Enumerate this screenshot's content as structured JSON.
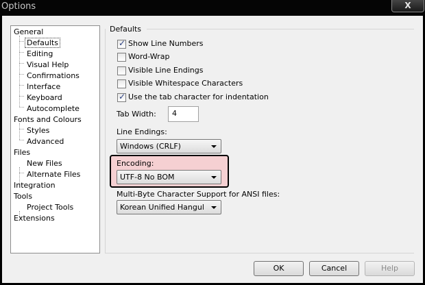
{
  "window": {
    "title": "Options",
    "close_glyph": "X"
  },
  "tree": {
    "items": [
      {
        "label": "General"
      },
      {
        "label": "Defaults",
        "selected": true
      },
      {
        "label": "Editing"
      },
      {
        "label": "Visual Help"
      },
      {
        "label": "Confirmations"
      },
      {
        "label": "Interface"
      },
      {
        "label": "Keyboard"
      },
      {
        "label": "Autocomplete"
      },
      {
        "label": "Fonts and Colours"
      },
      {
        "label": "Styles"
      },
      {
        "label": "Advanced"
      },
      {
        "label": "Files"
      },
      {
        "label": "New Files"
      },
      {
        "label": "Alternate Files"
      },
      {
        "label": "Integration"
      },
      {
        "label": "Tools"
      },
      {
        "label": "Project Tools"
      },
      {
        "label": "Extensions"
      }
    ]
  },
  "defaults": {
    "group_title": "Defaults",
    "checkboxes": [
      {
        "label": "Show Line Numbers",
        "checked": true
      },
      {
        "label": "Word-Wrap",
        "checked": false
      },
      {
        "label": "Visible Line Endings",
        "checked": false
      },
      {
        "label": "Visible Whitespace Characters",
        "checked": false
      },
      {
        "label": "Use the tab character for indentation",
        "checked": true
      }
    ],
    "check_glyph": "✓",
    "tab_width_label": "Tab Width:",
    "tab_width_value": "4",
    "line_endings_label": "Line Endings:",
    "line_endings_value": "Windows (CRLF)",
    "encoding_label": "Encoding:",
    "encoding_value": "UTF-8 No BOM",
    "mbcs_label": "Multi-Byte Character Support for ANSI files:",
    "mbcs_value": "Korean Unified Hangul"
  },
  "buttons": {
    "ok": "OK",
    "cancel": "Cancel",
    "help": "Help"
  },
  "colors": {
    "highlight": "#f5d0d2",
    "titlebar": "#050505"
  }
}
